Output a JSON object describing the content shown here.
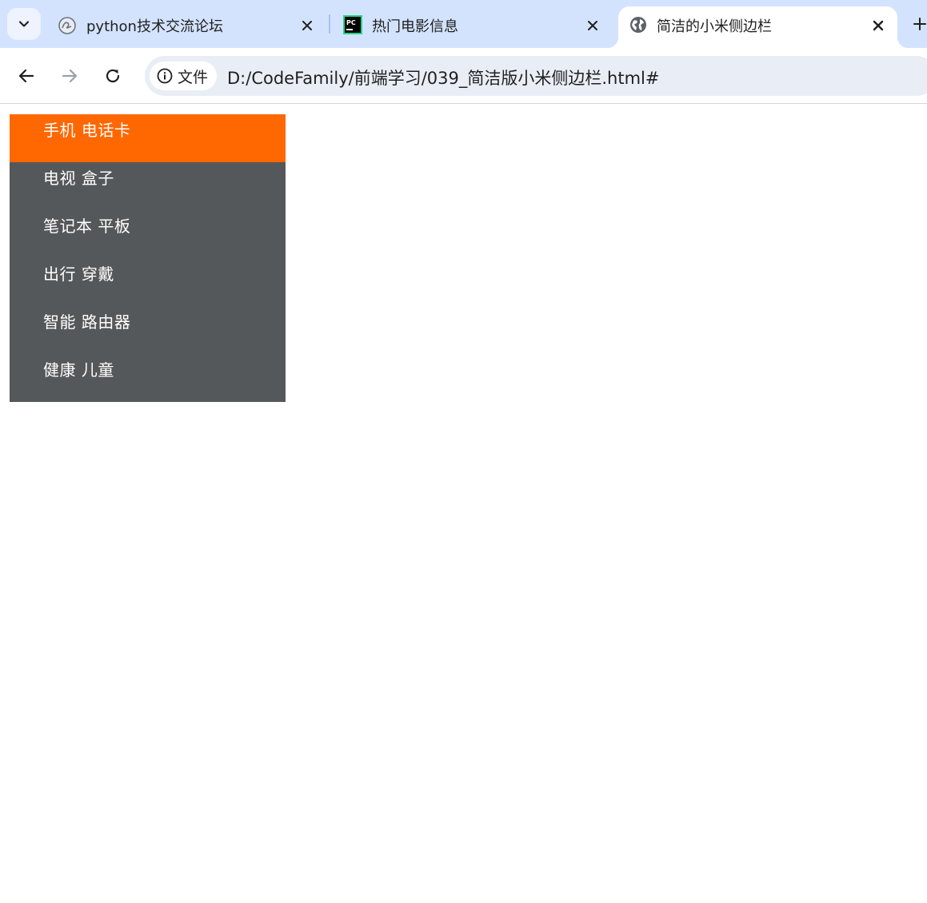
{
  "browser": {
    "tabs": [
      {
        "title": "python技术交流论坛",
        "icon": "forum-logo-icon",
        "active": false
      },
      {
        "title": "热门电影信息",
        "icon": "pycharm-icon",
        "active": false
      },
      {
        "title": "简洁的小米侧边栏",
        "icon": "globe-icon",
        "active": true
      }
    ],
    "omnibox": {
      "site_chip_label": "文件",
      "url": "D:/CodeFamily/前端学习/039_简洁版小米侧边栏.html#"
    }
  },
  "sidebar": {
    "items": [
      {
        "label": "手机 电话卡",
        "active": true
      },
      {
        "label": "电视 盒子",
        "active": false
      },
      {
        "label": "笔记本 平板",
        "active": false
      },
      {
        "label": "出行 穿戴",
        "active": false
      },
      {
        "label": "智能 路由器",
        "active": false
      },
      {
        "label": "健康 儿童",
        "active": false
      }
    ]
  },
  "colors": {
    "tabstrip_bg": "#d3e3fd",
    "sidebar_bg": "#55585a",
    "sidebar_active_bg": "#ff6700",
    "sidebar_text": "#ffffff"
  }
}
